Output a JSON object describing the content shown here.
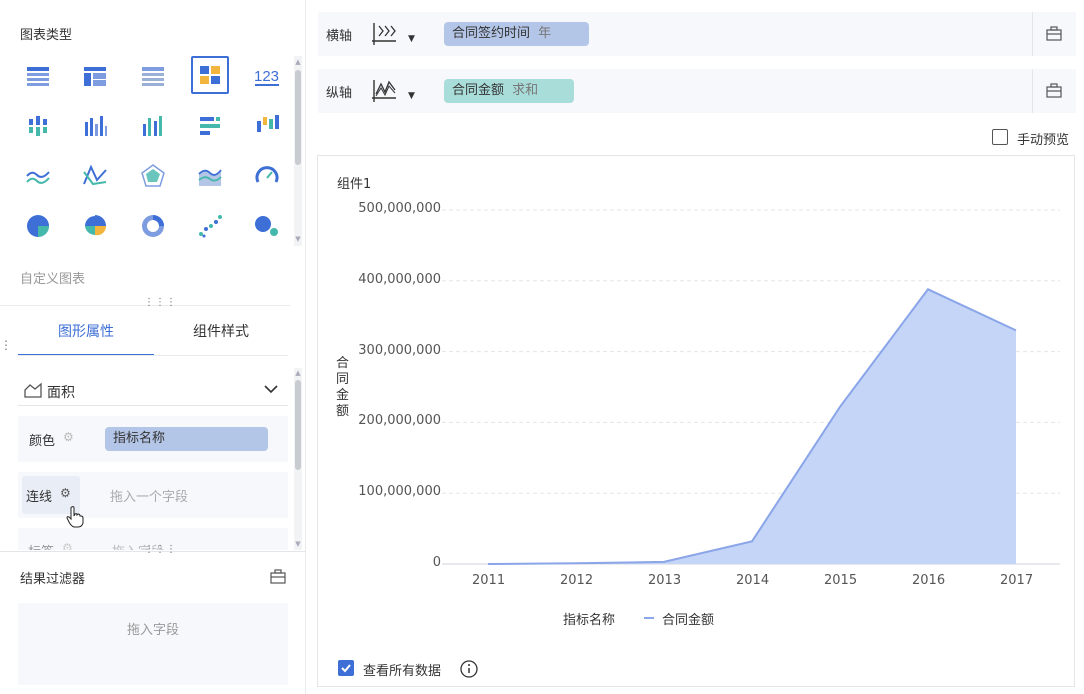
{
  "chart_type_panel": {
    "title": "图表类型",
    "custom_label": "自定义图表"
  },
  "props_panel": {
    "tabs": [
      {
        "label": "图形属性",
        "active": true
      },
      {
        "label": "组件样式",
        "active": false
      }
    ],
    "shape": "面积",
    "color_label": "颜色",
    "color_field": "指标名称",
    "line_label": "连线",
    "line_placeholder": "拖入一个字段",
    "label_label": "标签",
    "label_placeholder": "拖入字段"
  },
  "filter_panel": {
    "title": "结果过滤器",
    "placeholder": "拖入字段"
  },
  "axes": {
    "x_label": "横轴",
    "x_field": "合同签约时间",
    "x_field_suffix": "年",
    "y_label": "纵轴",
    "y_field": "合同金额",
    "y_field_suffix": "求和"
  },
  "manual_preview": "手动预览",
  "component_title": "组件1",
  "view_all_data": "查看所有数据",
  "colors": {
    "accent": "#3d6fd6",
    "x_pill": "#b4c6e7",
    "y_pill": "#a9ddd9",
    "area_fill": "#c5d5f8",
    "area_line": "#8aa5e8"
  },
  "chart_data": {
    "type": "area",
    "categories": [
      "2011",
      "2012",
      "2013",
      "2014",
      "2015",
      "2016",
      "2017"
    ],
    "series": [
      {
        "name": "合同金额",
        "values": [
          0,
          1000000,
          3000000,
          32000000,
          222000000,
          388000000,
          330000000
        ]
      }
    ],
    "ylabel": "合同金额",
    "yticks": [
      "500,000,000",
      "400,000,000",
      "300,000,000",
      "200,000,000",
      "100,000,000",
      "0"
    ],
    "ylim": [
      0,
      500000000
    ],
    "legend_title": "指标名称",
    "legend_position": "bottom",
    "grid": true
  }
}
